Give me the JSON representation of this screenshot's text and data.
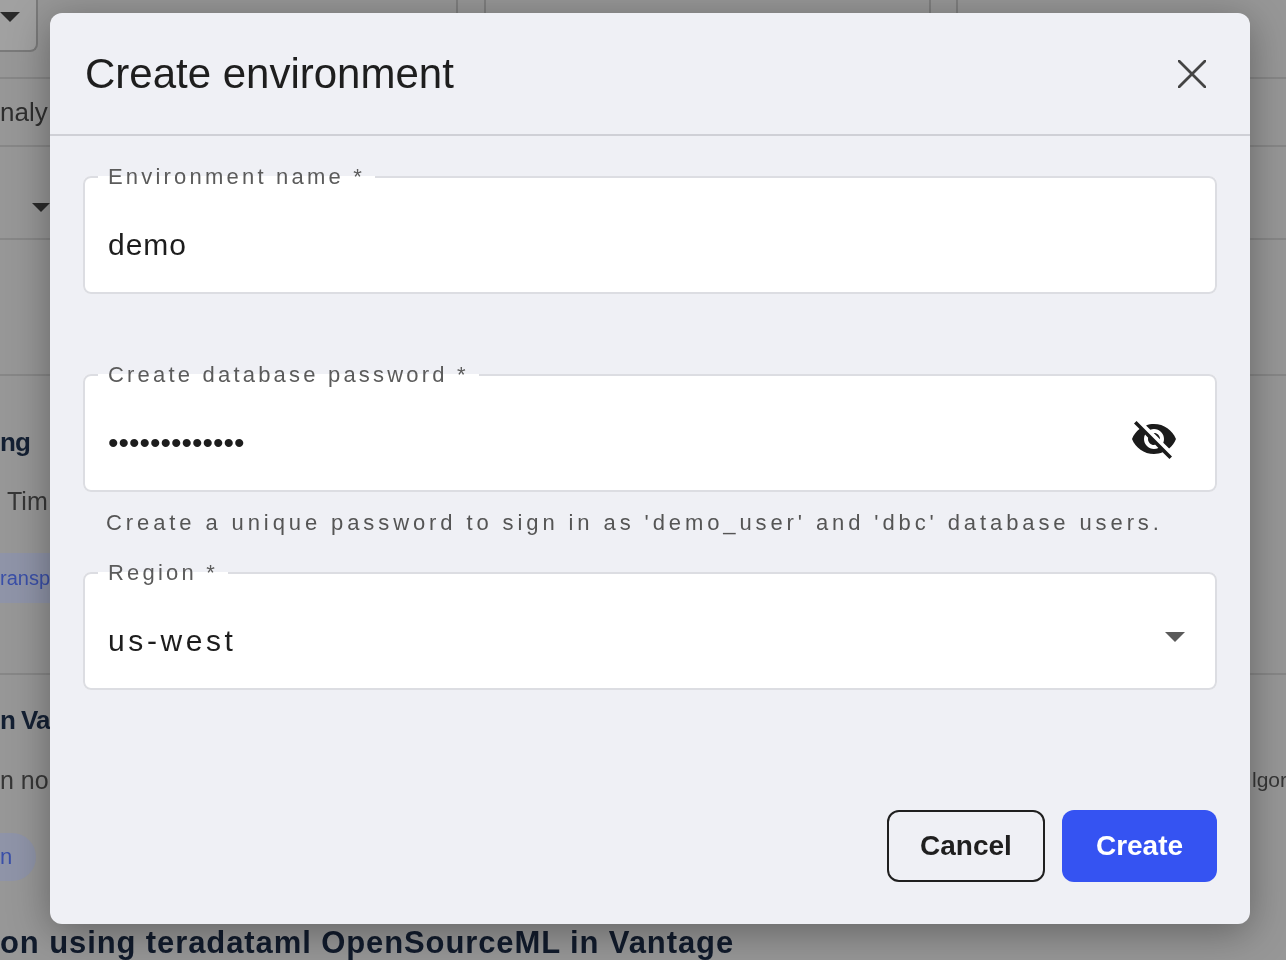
{
  "background": {
    "filter_text": "naly",
    "cards": [
      {
        "title": "ng",
        "description": "Tim",
        "tag": "ransp"
      },
      {
        "title": "n Va",
        "description": "n no",
        "description_end": "lgor",
        "tag": "n"
      },
      {
        "title": "on using teradataml OpenSourceML in Vantage"
      }
    ]
  },
  "dialog": {
    "title": "Create environment",
    "fields": [
      {
        "kind": "text",
        "label": "Environment name *",
        "value": "demo"
      },
      {
        "kind": "password",
        "label": "Create database password *",
        "value": "•••••••••••••",
        "masked": true,
        "helper": "Create a unique password to sign in as 'demo_user' and 'dbc' database users."
      },
      {
        "kind": "select",
        "label": "Region *",
        "value": "us-west"
      }
    ],
    "buttons": [
      {
        "kind": "secondary",
        "label": "Cancel"
      },
      {
        "kind": "primary",
        "label": "Create"
      }
    ]
  }
}
